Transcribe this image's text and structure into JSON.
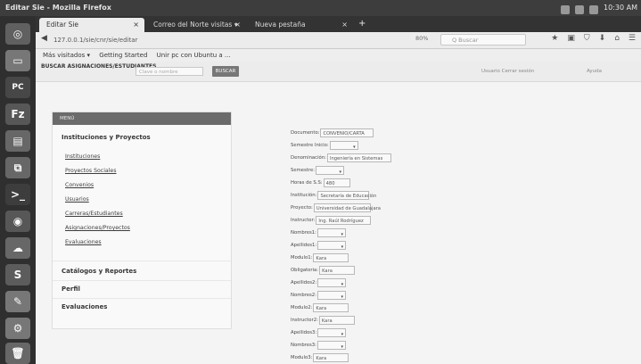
{
  "os": {
    "window_title": "Editar Sie - Mozilla Firefox",
    "clock": "10:30 AM"
  },
  "launcher": {
    "items": [
      "files",
      "home-folder",
      "pycharm",
      "filezilla",
      "monitor",
      "network",
      "terminal",
      "chrome",
      "ubuntu-one",
      "skype",
      "editor",
      "settings",
      "trash"
    ]
  },
  "browser": {
    "tabs": [
      {
        "label": "Editar Sie",
        "active": true
      },
      {
        "label": "Correo del Norte visitas ▾",
        "active": false
      },
      {
        "label": "Nueva pestaña",
        "active": false
      }
    ],
    "url": "127.0.0.1/sie/cnr/sie/editar",
    "zoom": "80%",
    "search_placeholder": "Q Buscar",
    "bookmarks": [
      "Más visitados ▾",
      "Getting Started",
      "Unir pc con Ubuntu a ..."
    ]
  },
  "page": {
    "top_label": "BUSCAR ASIGNACIONES/ESTUDIANTES",
    "top_input_placeholder": "Clave o nombre",
    "top_button": "BUSCAR",
    "right_text_1": "Usuario   Cerrar sesión",
    "right_text_2": "Ayuda",
    "sidebar": {
      "header": "MENÚ",
      "section1": "Instituciones y Proyectos",
      "links": [
        "Instituciones",
        "Proyectos Sociales",
        "Convenios",
        "Usuarios",
        "Carreras/Estudiantes",
        "Asignaciones/Proyectos",
        "Evaluaciones"
      ],
      "section2": "Catálogos y Reportes",
      "section3": "Perfil",
      "section4": "Evaluaciones"
    },
    "form": [
      {
        "label": "Documento:",
        "type": "input",
        "value": "CONVENIO/CARTA",
        "w": 60
      },
      {
        "label": "Semestre Inicio:",
        "type": "select",
        "value": ""
      },
      {
        "label": "Denominación:",
        "type": "input",
        "value": "Ingeniería en Sistemas",
        "w": 72
      },
      {
        "label": "Semestre:",
        "type": "select",
        "value": ""
      },
      {
        "label": "Horas de S.S:",
        "type": "input",
        "value": "480",
        "w": 30
      },
      {
        "label": "Institución:",
        "type": "input",
        "value": "Secretaría de Educación",
        "w": 58
      },
      {
        "label": "Proyecto:",
        "type": "input",
        "value": "Universidad de Guadalajara",
        "w": 64
      },
      {
        "label": "Instructor:",
        "type": "input",
        "value": "Ing. Raúl Rodríguez",
        "w": 62
      },
      {
        "label": "Nombres1:",
        "type": "select",
        "value": ""
      },
      {
        "label": "Apellidos1:",
        "type": "select",
        "value": ""
      },
      {
        "label": "Modulo1:",
        "type": "input",
        "value": "Kara",
        "w": 40
      },
      {
        "label": "Obligatoria:",
        "type": "input",
        "value": "Kara",
        "w": 40
      },
      {
        "label": "Apellidos2:",
        "type": "select",
        "value": ""
      },
      {
        "label": "Nombres2:",
        "type": "select",
        "value": ""
      },
      {
        "label": "Modulo2:",
        "type": "input",
        "value": "Kara",
        "w": 40
      },
      {
        "label": "Instructor2:",
        "type": "input",
        "value": "Kara",
        "w": 40
      },
      {
        "label": "Apellidos3:",
        "type": "select",
        "value": ""
      },
      {
        "label": "Nombres3:",
        "type": "select",
        "value": ""
      },
      {
        "label": "Modulo3:",
        "type": "input",
        "value": "Kara",
        "w": 40
      }
    ]
  }
}
